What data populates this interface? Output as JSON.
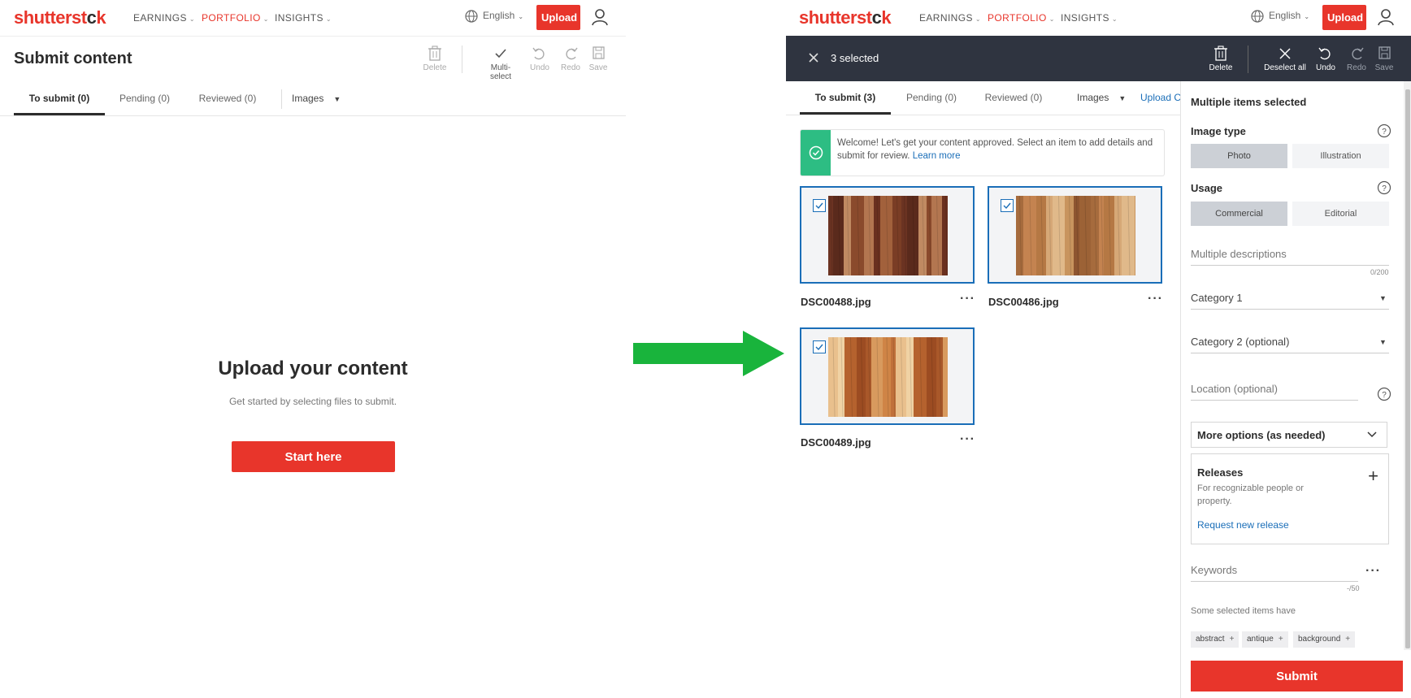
{
  "colors": {
    "accent": "#e8352b",
    "link": "#1a6eb8",
    "success": "#2dbd83",
    "arrow": "#19b43c",
    "dark_bar": "#2f3440"
  },
  "nav": {
    "logo_part1": "shutterst",
    "logo_part2": "c",
    "logo_part3": "k",
    "earnings": "EARNINGS",
    "portfolio": "PORTFOLIO",
    "insights": "INSIGHTS",
    "language": "English",
    "upload": "Upload",
    "icons": [
      "globe-icon",
      "user-icon",
      "chevron-down-icon"
    ]
  },
  "left": {
    "title": "Submit content",
    "toolbar": {
      "delete": "Delete",
      "multiselect": "Multi-select",
      "undo": "Undo",
      "redo": "Redo",
      "save": "Save"
    },
    "tabs": {
      "to_submit": "To submit (0)",
      "pending": "Pending (0)",
      "reviewed": "Reviewed (0)"
    },
    "filter": "Images",
    "empty_title": "Upload your content",
    "empty_sub": "Get started by selecting files to submit.",
    "start": "Start here"
  },
  "right": {
    "selected": "3 selected",
    "toolbar": {
      "delete": "Delete",
      "deselect": "Deselect all",
      "undo": "Undo",
      "redo": "Redo",
      "save": "Save"
    },
    "tabs": {
      "to_submit": "To submit (3)",
      "pending": "Pending (0)",
      "reviewed": "Reviewed (0)"
    },
    "filter": "Images",
    "upload_link": "Upload C",
    "notice": {
      "text": "Welcome! Let's get your content approved. Select an item to add details and submit for review.",
      "link": "Learn more"
    },
    "files": [
      {
        "name": "DSC00488.jpg",
        "palette": [
          "#6b3322",
          "#8a4a2c",
          "#a2613c",
          "#5a2a1c",
          "#b37650",
          "#7a3d25",
          "#c08a62",
          "#6a301f"
        ]
      },
      {
        "name": "DSC00486.jpg",
        "palette": [
          "#c8945e",
          "#a66b3d",
          "#d6a877",
          "#8e5530",
          "#c48350",
          "#e0b98a",
          "#9c6236",
          "#b57844"
        ]
      },
      {
        "name": "DSC00489.jpg",
        "palette": [
          "#b5622e",
          "#d89a5e",
          "#e9c08d",
          "#9c4c22",
          "#cf8446",
          "#f0d2a4",
          "#a9582a",
          "#c0703a"
        ]
      }
    ],
    "side": {
      "header": "Multiple items selected",
      "image_type": "Image type",
      "photo": "Photo",
      "illustration": "Illustration",
      "usage": "Usage",
      "commercial": "Commercial",
      "editorial": "Editorial",
      "descriptions": "Multiple descriptions",
      "desc_count": "0/200",
      "category1": "Category 1",
      "category2": "Category 2 (optional)",
      "location": "Location (optional)",
      "more_options": "More options (as needed)",
      "releases_title": "Releases",
      "releases_desc": "For recognizable people or property.",
      "releases_link": "Request new release",
      "keywords": "Keywords",
      "kw_count": "-/50",
      "tag_note": "Some selected items have",
      "tags": [
        "abstract",
        "antique",
        "background"
      ],
      "submit": "Submit"
    }
  }
}
